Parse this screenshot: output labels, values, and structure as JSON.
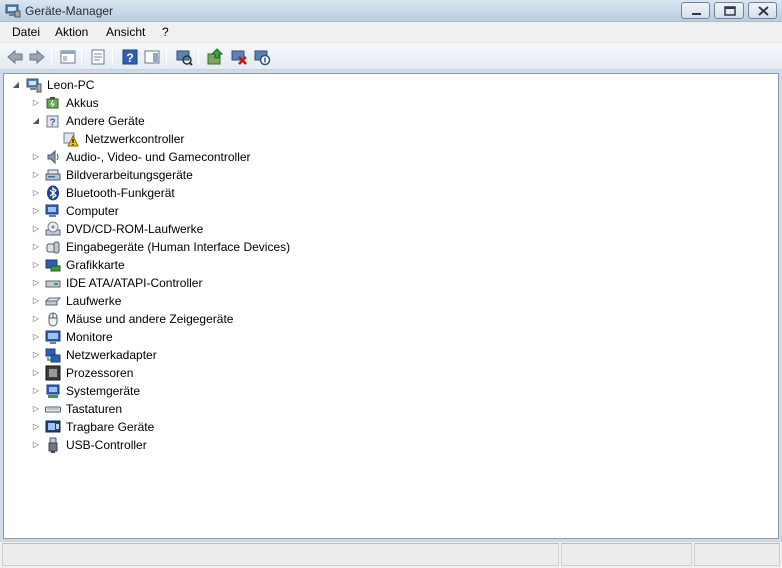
{
  "window": {
    "title": "Geräte-Manager",
    "icon": "device-manager-icon"
  },
  "menu": {
    "items": [
      "Datei",
      "Aktion",
      "Ansicht",
      "?"
    ]
  },
  "toolbar": {
    "buttons": [
      "back-icon",
      "forward-icon",
      "console-tree-icon",
      "properties-icon",
      "help-icon",
      "action-pane-icon",
      "scan-hardware-icon",
      "update-driver-icon",
      "uninstall-icon",
      "disable-icon"
    ]
  },
  "tree": {
    "root": "Leon-PC",
    "items": [
      {
        "label": "Akkus",
        "expanded": false
      },
      {
        "label": "Andere Geräte",
        "expanded": true
      },
      {
        "label": "Netzwerkcontroller",
        "child": true,
        "warning": true
      },
      {
        "label": "Audio-, Video- und Gamecontroller",
        "expanded": false
      },
      {
        "label": "Bildverarbeitungsgeräte",
        "expanded": false
      },
      {
        "label": "Bluetooth-Funkgerät",
        "expanded": false
      },
      {
        "label": "Computer",
        "expanded": false
      },
      {
        "label": "DVD/CD-ROM-Laufwerke",
        "expanded": false
      },
      {
        "label": "Eingabegeräte (Human Interface Devices)",
        "expanded": false
      },
      {
        "label": "Grafikkarte",
        "expanded": false
      },
      {
        "label": "IDE ATA/ATAPI-Controller",
        "expanded": false
      },
      {
        "label": "Laufwerke",
        "expanded": false
      },
      {
        "label": "Mäuse und andere Zeigegeräte",
        "expanded": false
      },
      {
        "label": "Monitore",
        "expanded": false
      },
      {
        "label": "Netzwerkadapter",
        "expanded": false
      },
      {
        "label": "Prozessoren",
        "expanded": false
      },
      {
        "label": "Systemgeräte",
        "expanded": false
      },
      {
        "label": "Tastaturen",
        "expanded": false
      },
      {
        "label": "Tragbare Geräte",
        "expanded": false
      },
      {
        "label": "USB-Controller",
        "expanded": false
      }
    ]
  },
  "colors": {
    "title_bar": "#c9d8e9",
    "tree_background": "#ffffff",
    "warning": "#f5c400"
  }
}
